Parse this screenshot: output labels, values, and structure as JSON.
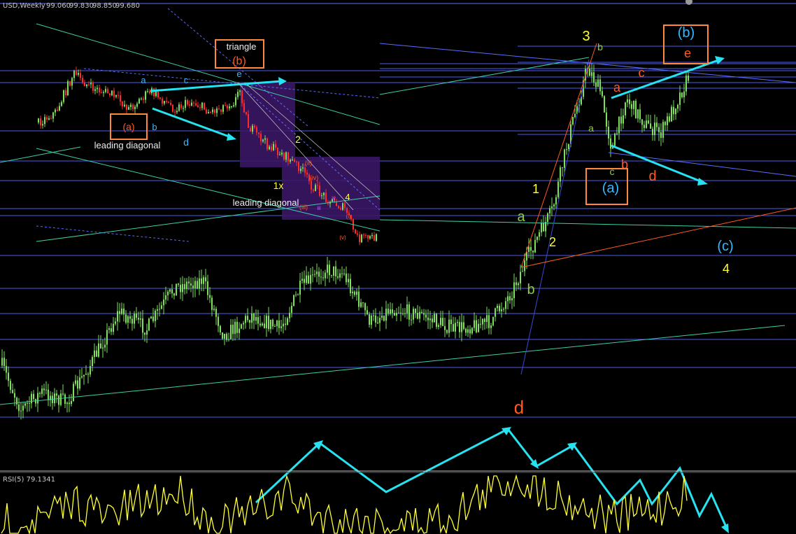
{
  "header": {
    "symbol": "USD,Weekly",
    "open": "99.060",
    "high": "99.830",
    "low": "98.850",
    "close": "99.680"
  },
  "rsi": {
    "label": "RSI(5) 79.1341",
    "color": "#ffff33"
  },
  "colors": {
    "background": "#000000",
    "candle": "#7fe05a",
    "hline": "#5a6bff",
    "trendline": "#3ccfa8",
    "arrow": "#25e3f0",
    "box": "#ff8a3d",
    "purple": "#4a1a78",
    "yellow": "#ffff33",
    "orange_text": "#ff5a1f",
    "cyan_text": "#35b8ff",
    "green_text": "#8fcf3f",
    "violet_text": "#c05cff"
  },
  "chart_data": {
    "type": "candlestick",
    "title": "",
    "xlabel": "",
    "ylabel": "",
    "labels_main": [
      {
        "text": "3",
        "color": "yellow"
      },
      {
        "text": "b",
        "color": "green"
      },
      {
        "text": "a",
        "color": "green"
      },
      {
        "text": "a",
        "color": "orange"
      },
      {
        "text": "c",
        "color": "orange"
      },
      {
        "text": "b",
        "color": "orange"
      },
      {
        "text": "d",
        "color": "orange"
      },
      {
        "text": "c",
        "color": "green"
      },
      {
        "text": "(a)",
        "color": "cyan"
      },
      {
        "text": "(b)",
        "color": "cyan"
      },
      {
        "text": "e",
        "color": "orange"
      },
      {
        "text": "1",
        "color": "yellow"
      },
      {
        "text": "2",
        "color": "yellow"
      },
      {
        "text": "a",
        "color": "green"
      },
      {
        "text": "b",
        "color": "green"
      },
      {
        "text": "(c)",
        "color": "cyan"
      },
      {
        "text": "4",
        "color": "yellow"
      },
      {
        "text": "d",
        "color": "orange"
      }
    ],
    "labels_inset": [
      {
        "text": "triangle",
        "color": "white"
      },
      {
        "text": "(b)",
        "color": "orange"
      },
      {
        "text": "e",
        "color": "cyan"
      },
      {
        "text": "a",
        "color": "cyan"
      },
      {
        "text": "c",
        "color": "cyan"
      },
      {
        "text": "(a)",
        "color": "orange"
      },
      {
        "text": "b",
        "color": "cyan"
      },
      {
        "text": "d",
        "color": "cyan"
      },
      {
        "text": "leading diagonal",
        "color": "white"
      },
      {
        "text": "leading diagonal",
        "color": "white"
      },
      {
        "text": "2",
        "color": "yellow"
      },
      {
        "text": "1x",
        "color": "yellow"
      },
      {
        "text": "4",
        "color": "yellow"
      },
      {
        "text": "iv",
        "color": "violet"
      },
      {
        "text": "iii",
        "color": "violet"
      },
      {
        "text": "(ii)",
        "color": "orange"
      },
      {
        "text": "(iv)",
        "color": "orange"
      },
      {
        "text": "(iii)",
        "color": "orange"
      },
      {
        "text": "(i)",
        "color": "orange"
      },
      {
        "text": "(v)",
        "color": "orange"
      }
    ],
    "grid": false
  }
}
